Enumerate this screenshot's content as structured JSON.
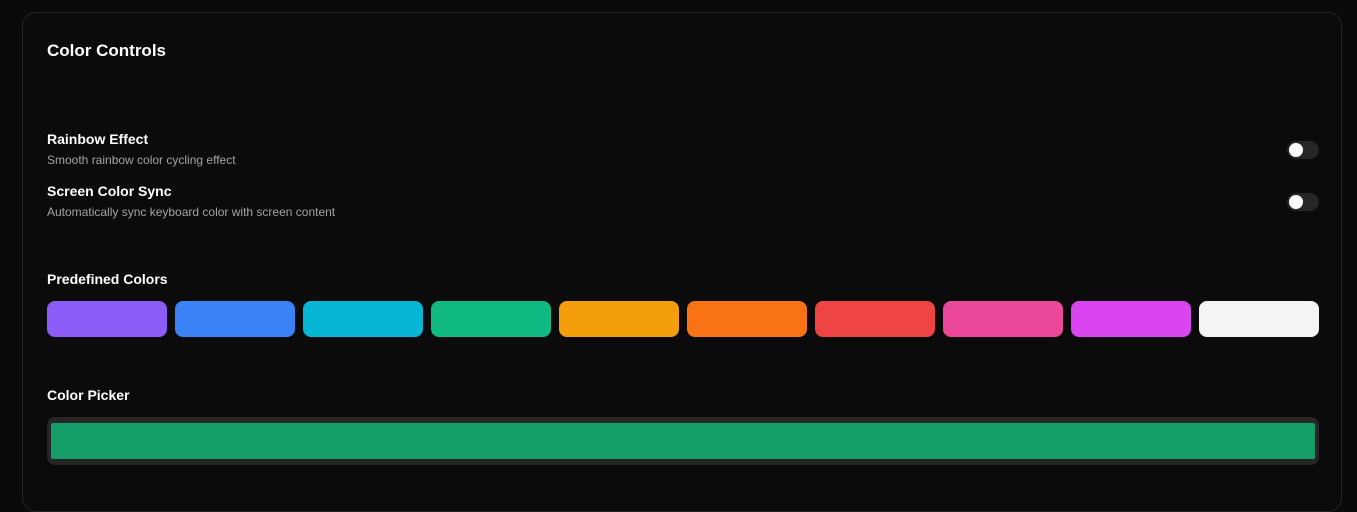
{
  "panel": {
    "title": "Color Controls"
  },
  "settings": [
    {
      "title": "Rainbow Effect",
      "description": "Smooth rainbow color cycling effect",
      "enabled": false
    },
    {
      "title": "Screen Color Sync",
      "description": "Automatically sync keyboard color with screen content",
      "enabled": false
    }
  ],
  "predefined": {
    "label": "Predefined Colors",
    "colors": [
      "#8b5cf6",
      "#3b82f6",
      "#06b6d4",
      "#10b981",
      "#f59e0b",
      "#f97316",
      "#ef4444",
      "#ec4899",
      "#d946ef",
      "#f3f4f6"
    ]
  },
  "picker": {
    "label": "Color Picker",
    "value": "#169e68"
  }
}
